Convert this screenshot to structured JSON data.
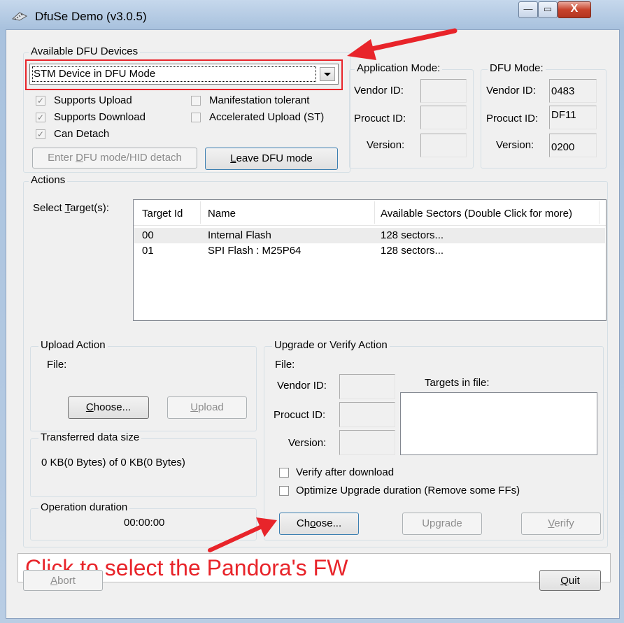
{
  "window": {
    "title": "DfuSe Demo (v3.0.5)",
    "min_label": "—",
    "max_label": "▭",
    "close_label": "X"
  },
  "dfu_devices": {
    "legend": "Available DFU Devices",
    "selected_device": "STM Device in DFU Mode",
    "supports_upload": "Supports Upload",
    "supports_download": "Supports Download",
    "can_detach": "Can Detach",
    "manifestation_tolerant": "Manifestation tolerant",
    "accelerated_upload": "Accelerated Upload (ST)",
    "enter_dfu_button_pre": "Enter ",
    "enter_dfu_button_u": "D",
    "enter_dfu_button_post": "FU mode/HID detach",
    "leave_dfu_button_u": "L",
    "leave_dfu_button_post": "eave DFU mode"
  },
  "application_mode": {
    "legend": "Application Mode:",
    "vendor_label": "Vendor ID:",
    "product_label": "Procuct ID:",
    "version_label": "Version:",
    "vendor_value": "",
    "product_value": "",
    "version_value": ""
  },
  "dfu_mode": {
    "legend": "DFU Mode:",
    "vendor_label": "Vendor ID:",
    "product_label": "Procuct ID:",
    "version_label": "Version:",
    "vendor_value": "0483",
    "product_value": "DF11",
    "version_value": "0200"
  },
  "actions": {
    "legend": "Actions",
    "select_target_pre": "Select ",
    "select_target_u": "T",
    "select_target_post": "arget(s):",
    "columns": [
      "Target Id",
      "Name",
      "Available Sectors (Double Click for more)"
    ],
    "rows": [
      {
        "id": "00",
        "name": "Internal Flash",
        "sectors": "128 sectors..."
      },
      {
        "id": "01",
        "name": "SPI Flash : M25P64",
        "sectors": "128 sectors..."
      }
    ]
  },
  "upload_action": {
    "legend": "Upload Action",
    "file_label": "File:",
    "choose_u": "C",
    "choose_post": "hoose...",
    "upload_u": "U",
    "upload_post": "pload"
  },
  "transferred": {
    "legend": "Transferred data size",
    "value": "0 KB(0 Bytes) of 0 KB(0 Bytes)"
  },
  "operation": {
    "legend": "Operation duration",
    "value": "00:00:00"
  },
  "upgrade_verify": {
    "legend": "Upgrade or Verify Action",
    "file_label": "File:",
    "vendor_label": "Vendor ID:",
    "product_label": "Procuct ID:",
    "version_label": "Version:",
    "targets_label": "Targets in file:",
    "verify_after_download": "Verify after download",
    "optimize_upgrade": "Optimize Upgrade duration (Remove some FFs)",
    "choose_pre": "Ch",
    "choose_u": "o",
    "choose_post": "ose...",
    "upgrade_label": "Upgrade",
    "verify_u": "V",
    "verify_post": "erify"
  },
  "status_text": "Click to select the Pandora's FW",
  "abort_u": "A",
  "abort_post": "bort",
  "quit_u": "Q",
  "quit_post": "uit",
  "colors": {
    "highlight_red": "#e8242a",
    "status_text_red": "#e8242a"
  }
}
